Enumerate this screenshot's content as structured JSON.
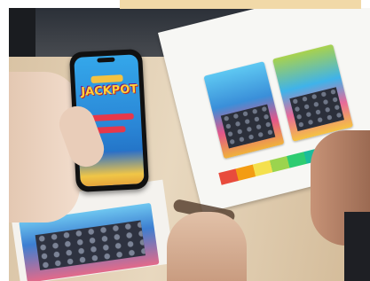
{
  "photo": {
    "description_icon": "photo-of-hands-holding-phone-with-scratch-ticket-game",
    "phone_screen": {
      "title": "JACKPOT"
    }
  }
}
